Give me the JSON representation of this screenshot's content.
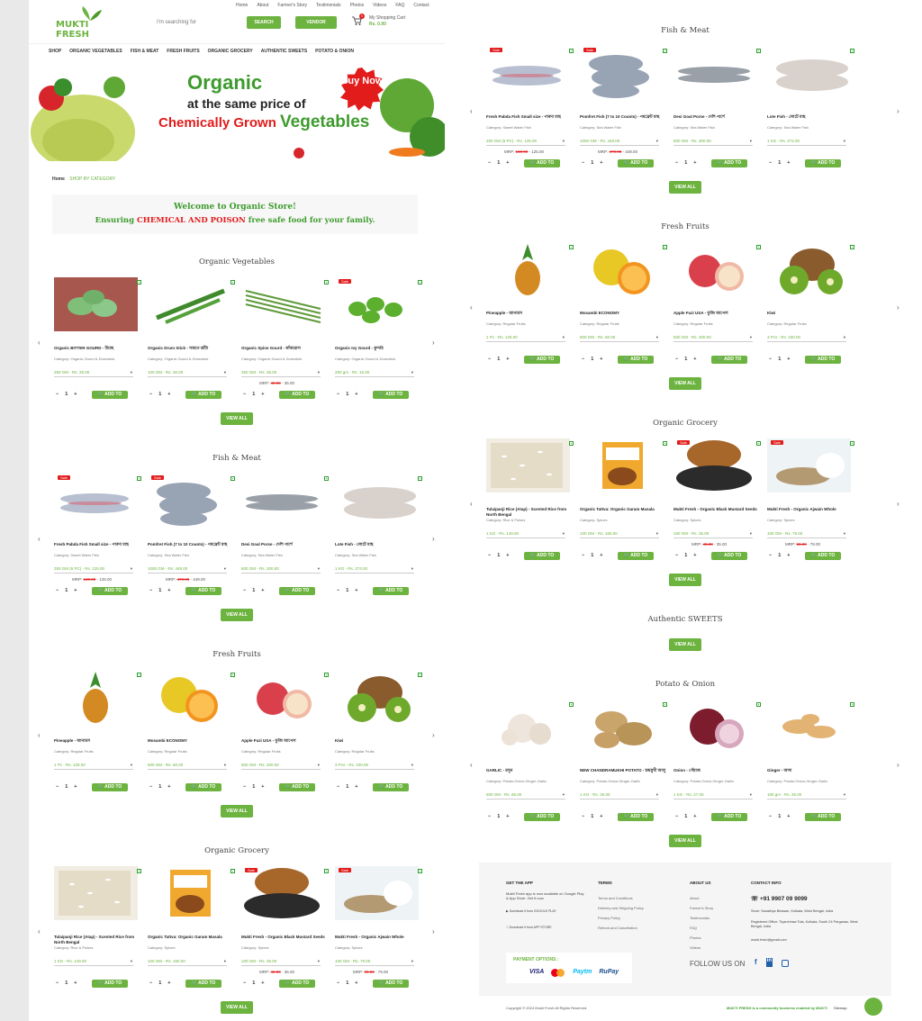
{
  "header": {
    "nav_links": [
      "Home",
      "About",
      "Farmer's Story",
      "Testimonials",
      "Photos",
      "Videos",
      "FAQ",
      "Contact"
    ],
    "brand": "MUKTI FRESH",
    "search_placeholder": "I'm searching for",
    "search_button": "SEARCH",
    "vendor_button": "VENDOR",
    "cart_label": "My Shopping Cart",
    "cart_amount": "Rs. 0.00",
    "cart_count": "0"
  },
  "category_nav": [
    "SHOP",
    "ORGANIC VEGETABLES",
    "FISH & MEAT",
    "FRESH FRUITS",
    "ORGANIC GROCERY",
    "AUTHENTIC SWEETS",
    "POTATO & ONION"
  ],
  "banner": {
    "line1": "Organic",
    "line2": "at the same price of",
    "line3a": "Chemically Grown",
    "line3b": "Vegetables",
    "badge": "Buy Now"
  },
  "breadcrumb": {
    "home": "Home",
    "current": "SHOP BY CATEGORY"
  },
  "welcome": {
    "line1": "Welcome to Organic Store!",
    "line2a": "Ensuring",
    "line2b": "CHEMICAL AND POISON",
    "line2c": "free safe food for your family."
  },
  "ui": {
    "add_to_cart": "ADD TO CART",
    "view_all": "VIEW ALL",
    "sale": "Sale",
    "mrp": "MRP:"
  },
  "sections": [
    {
      "title": "Organic Vegetables",
      "products": [
        {
          "name": "Organic BITTER GOURD - উচ্ছে",
          "category": "Category: Organic Gourd & Drumstick",
          "option": "250 GM - Rs. 25.00",
          "mrp_old": "",
          "mrp_new": "",
          "sale": false
        },
        {
          "name": "Organic Drum Stick - সজনে ডাঁটা",
          "category": "Category: Organic Gourd & Drumstick",
          "option": "100 GM - Rs. 30.00",
          "mrp_old": "",
          "mrp_new": "",
          "sale": false
        },
        {
          "name": "Organic Spine Gourd - কাঁকরোল",
          "category": "Category: Organic Gourd & Drumstick",
          "option": "250 GM - Rs. 35.00",
          "mrp_old": "40.00",
          "mrp_new": "35.00",
          "sale": false
        },
        {
          "name": "Organic Ivy Gourd - কুন্দরি",
          "category": "Category: Organic Gourd & Drumstick",
          "option": "250 gm - Rs. 15.00",
          "mrp_old": "",
          "mrp_new": "",
          "sale": true
        }
      ]
    },
    {
      "title": "Fish & Meat",
      "products": [
        {
          "name": "Fresh Pabda Fish Small size - পাবদা মাছ",
          "category": "Category: Sweet Water Fish",
          "option": "250 GM (6 PC) - Rs. 125.00",
          "mrp_old": "130.00",
          "mrp_new": "125.00",
          "sale": true
        },
        {
          "name": "Pomfret Fish (7 to 10 Counts) - পমফ্রেট মাছ",
          "category": "Category: Sea Water Fish",
          "option": "1000 GM - Rs. 449.00",
          "mrp_old": "470.00",
          "mrp_new": "449.00",
          "sale": true
        },
        {
          "name": "Desi Goal Porse - দেশি পার্শে",
          "category": "Category: Sea Water Fish",
          "option": "500 GM - Rs. 300.00",
          "mrp_old": "",
          "mrp_new": "",
          "sale": false
        },
        {
          "name": "Lote Fish - লোটে মাছ",
          "category": "Category: Sea Water Fish",
          "option": "1 KG - Rs. 274.00",
          "mrp_old": "",
          "mrp_new": "",
          "sale": false
        }
      ]
    },
    {
      "title": "Fresh Fruits",
      "products": [
        {
          "name": "Pineapple - আনারস",
          "category": "Category: Regular Fruits",
          "option": "1 Pc - Rs. 125.00",
          "mrp_old": "",
          "mrp_new": "",
          "sale": false
        },
        {
          "name": "Mosambi ECONOMY",
          "category": "Category: Regular Fruits",
          "option": "500 GM - Rs. 60.00",
          "mrp_old": "",
          "mrp_new": "",
          "sale": false
        },
        {
          "name": "Apple Fuzi USA - ফুজি আপেল",
          "category": "Category: Regular Fruits",
          "option": "500 GM - Rs. 200.00",
          "mrp_old": "",
          "mrp_new": "",
          "sale": false
        },
        {
          "name": "Kiwi",
          "category": "Category: Regular Fruits",
          "option": "3 Pcs - Rs. 100.00",
          "mrp_old": "",
          "mrp_new": "",
          "sale": false
        }
      ]
    },
    {
      "title": "Organic Grocery",
      "products": [
        {
          "name": "Tulaipanji Rice (Atap) - Scented Rice from North Bengal",
          "category": "Category: Rice & Pulses",
          "option": "1 KG - Rs. 149.00",
          "mrp_old": "",
          "mrp_new": "",
          "sale": false
        },
        {
          "name": "Organic Tattva: Organic Garam Masala",
          "category": "Category: Spices",
          "option": "100 GM - Rs. 160.00",
          "mrp_old": "",
          "mrp_new": "",
          "sale": false
        },
        {
          "name": "Mukti Fresh - Organic Black Mustard Seeds",
          "category": "Category: Spices",
          "option": "100 GM - Rs. 35.00",
          "mrp_old": "40.00",
          "mrp_new": "35.00",
          "sale": true
        },
        {
          "name": "Mukti Fresh - Organic Ajwain Whole",
          "category": "Category: Spices",
          "option": "100 GM - Rs. 79.00",
          "mrp_old": "90.00",
          "mrp_new": "79.00",
          "sale": true
        }
      ]
    },
    {
      "title": "Authentic SWEETS",
      "products": []
    },
    {
      "title": "Potato & Onion",
      "products": [
        {
          "name": "GARLIC - রসুন",
          "category": "Category: Potato-Onion-Ginger-Garlic",
          "option": "500 GM - Rs. 65.00",
          "mrp_old": "",
          "mrp_new": "",
          "sale": false
        },
        {
          "name": "NEW CHANDRAMUKHI POTATO - চন্দ্রমুখী আলু",
          "category": "Category: Potato-Onion-Ginger-Garlic",
          "option": "1 KG - Rs. 25.00",
          "mrp_old": "",
          "mrp_new": "",
          "sale": false
        },
        {
          "name": "Onion - পেঁয়াজ",
          "category": "Category: Potato-Onion-Ginger-Garlic",
          "option": "1 KG - Rs. 27.00",
          "mrp_old": "",
          "mrp_new": "",
          "sale": false
        },
        {
          "name": "Ginger - আদা",
          "category": "Category: Potato-Onion-Ginger-Garlic",
          "option": "100 gm - Rs. 25.00",
          "mrp_old": "",
          "mrp_new": "",
          "sale": false
        }
      ]
    }
  ],
  "footer": {
    "get_app_title": "GET THE APP",
    "get_app_text": "Mukti Fresh app is now available on Google Play & App Store. Get it now.",
    "play_store": "Download it from GOOGLE PLAY",
    "app_store": "Download it from APP STORE",
    "payment_title": "PAYMENT OPTIONS :",
    "payments": [
      "VISA",
      "Mastercard",
      "Paytm",
      "RuPay"
    ],
    "terms_title": "TERMS",
    "terms": [
      "Terms and Conditions",
      "Delivery and Shipping Policy",
      "Privacy Policy",
      "Refund and Cancellation"
    ],
    "about_title": "ABOUT US",
    "about": [
      "About",
      "Farmer's Story",
      "Testimonials",
      "FAQ",
      "Photos",
      "Videos"
    ],
    "contact_title": "CONTACT INFO",
    "phone": "+91 9907 09 9099",
    "store": "Store: Swasthya Bhawan, Kolkata, West Bengal, India",
    "office": "Registered Office: Tiyarchhaw Tola, Kolkata, South 24 Parganas, West Bengal, India",
    "email": "mukti.fresh@gmail.com",
    "follow": "FOLLOW US ON",
    "copyright": "Copyright © 2024 Mukti Fresh All Rights Reserved.",
    "community": "MUKTI FRESH is a community business enabled by MUKTI",
    "sitemap": "Sitemap"
  },
  "colors": {
    "accent": "#6cb33f",
    "red": "#e21b1b",
    "dark_green": "#3d9b2d"
  }
}
